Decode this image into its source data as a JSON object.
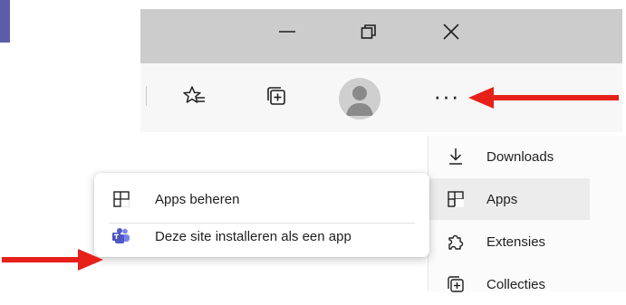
{
  "window_controls": {
    "minimize_icon": "minimize-icon",
    "restore_icon": "restore-icon",
    "close_icon": "close-icon"
  },
  "toolbar": {
    "favorites_icon": "favorites-icon",
    "collections_icon": "collections-icon",
    "profile_icon": "profile-avatar-icon",
    "more_label": "···"
  },
  "settings_menu": {
    "items": [
      {
        "label": "Downloads",
        "icon": "download-icon"
      },
      {
        "label": "Apps",
        "icon": "apps-icon"
      },
      {
        "label": "Extensies",
        "icon": "puzzle-icon"
      },
      {
        "label": "Collecties",
        "icon": "collections-icon"
      }
    ]
  },
  "apps_submenu": {
    "items": [
      {
        "label": "Apps beheren",
        "icon": "apps-icon"
      },
      {
        "label": "Deze site installeren als een app",
        "icon": "teams-icon"
      }
    ]
  },
  "colors": {
    "arrow": "#e8201a",
    "accent": "#5b5ea6",
    "teams": "#5059c9"
  }
}
